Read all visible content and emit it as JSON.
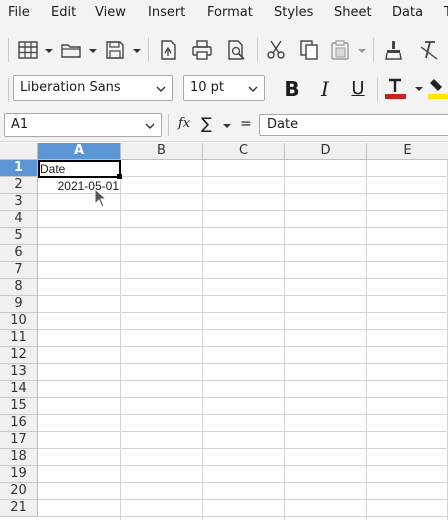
{
  "menubar": {
    "items": [
      "File",
      "Edit",
      "View",
      "Insert",
      "Format",
      "Styles",
      "Sheet",
      "Data",
      "T"
    ]
  },
  "toolbar": {
    "icons": [
      "table-icon",
      "open-icon",
      "save-icon",
      "export-pdf-icon",
      "print-icon",
      "print-preview-icon",
      "cut-icon",
      "copy-icon",
      "paste-icon",
      "clone-formatting-icon",
      "clear-formatting-icon"
    ]
  },
  "formatting": {
    "font_name": "Liberation Sans",
    "font_size": "10 pt",
    "bold": "B",
    "italic": "I",
    "underline": "U",
    "font_color": "#c9211e",
    "highlight_color": "#ffe500"
  },
  "formula_bar": {
    "name_box": "A1",
    "function_wizard": "fx",
    "sum_symbol": "∑",
    "equals": "=",
    "content": "Date"
  },
  "sheet": {
    "columns": [
      "A",
      "B",
      "C",
      "D",
      "E"
    ],
    "selected_column": "A",
    "rows": [
      "1",
      "2",
      "3",
      "4",
      "5",
      "6",
      "7",
      "8",
      "9",
      "10",
      "11",
      "12",
      "13",
      "14",
      "15",
      "16",
      "17",
      "18",
      "19",
      "20",
      "21"
    ],
    "selected_row": "1",
    "cells": {
      "A1": "Date",
      "A2": "2021-05-01"
    }
  }
}
